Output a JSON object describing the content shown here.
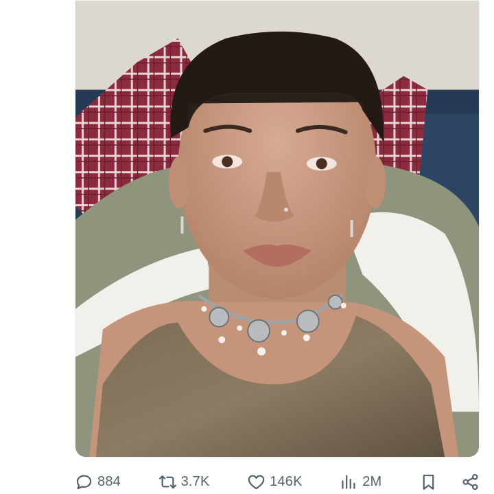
{
  "tweet": {
    "media": {
      "alt": ""
    },
    "actions": {
      "reply": {
        "icon": "reply-icon",
        "count": "884"
      },
      "retweet": {
        "icon": "retweet-icon",
        "count": "3.7K"
      },
      "like": {
        "icon": "heart-icon",
        "count": "146K"
      },
      "views": {
        "icon": "bar-chart-icon",
        "count": "2M"
      },
      "bookmark": {
        "icon": "bookmark-icon"
      },
      "share": {
        "icon": "share-icon"
      }
    },
    "colors": {
      "icon_gray": "#536471",
      "wall": "#dcd8d0",
      "couch_blue": "#243a55",
      "blanket_green": "#8f947d",
      "sherpa_white": "#f2f0ea",
      "plaid_red": "#8c2b3d",
      "skin": "#c99a80",
      "hair": "#231a16",
      "tank_top": "#7a6a52"
    }
  }
}
